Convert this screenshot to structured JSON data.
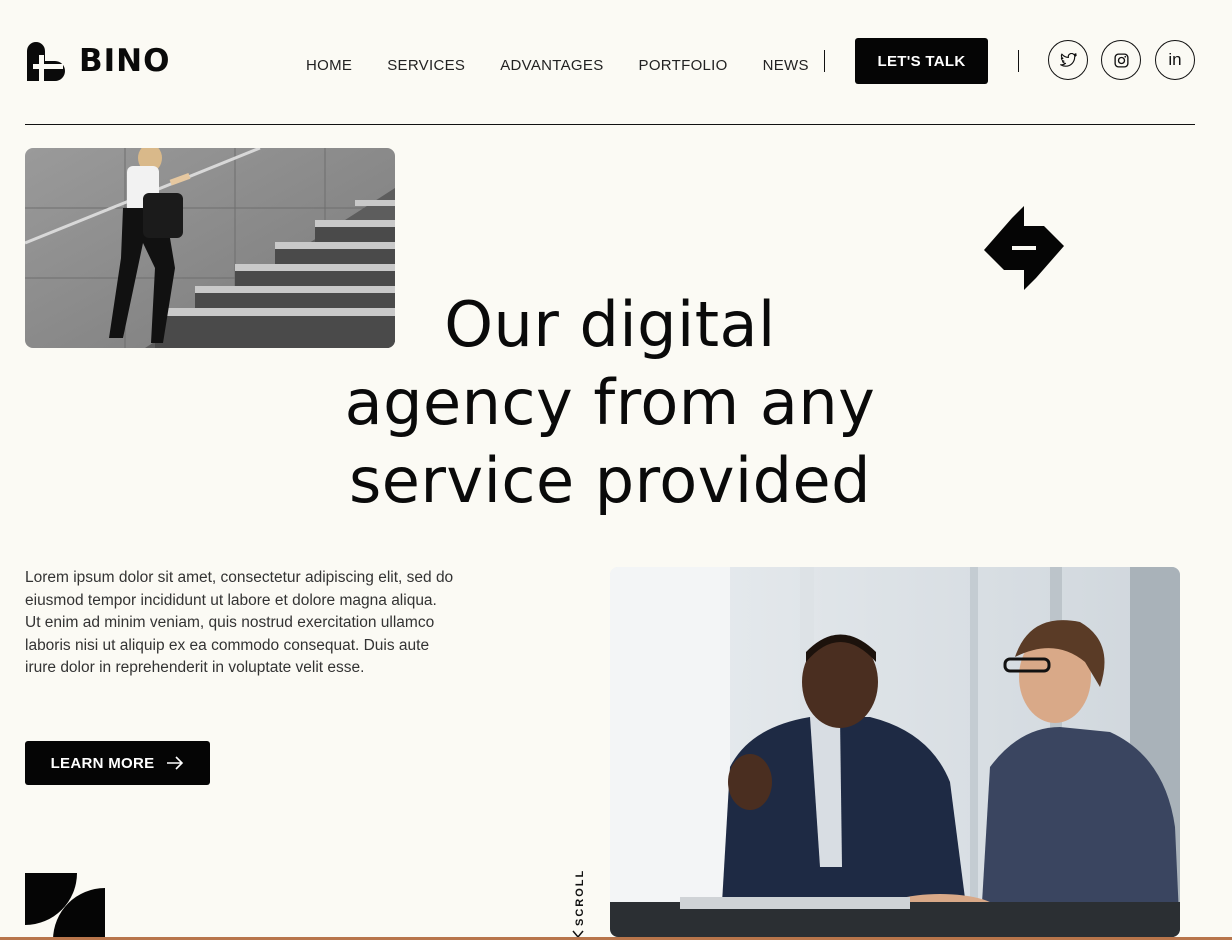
{
  "brand": {
    "name": "BINO"
  },
  "nav": {
    "items": [
      "HOME",
      "SERVICES",
      "ADVANTAGES",
      "PORTFOLIO",
      "NEWS"
    ],
    "cta": "LET'S TALK"
  },
  "social": [
    {
      "icon": "twitter-icon"
    },
    {
      "icon": "instagram-icon"
    },
    {
      "icon": "linkedin-icon",
      "text": "in"
    }
  ],
  "hero": {
    "title_lines": [
      "Our digital",
      "agency from any",
      "service provided"
    ],
    "description": "Lorem ipsum dolor sit amet, consectetur adipiscing elit, sed do eiusmod tempor incididunt ut labore et dolore magna aliqua. Ut enim ad minim veniam, quis nostrud exercitation ullamco laboris nisi ut aliquip ex ea commodo consequat. Duis aute irure dolor in reprehenderit in voluptate velit esse.",
    "button_label": "LEARN MORE",
    "scroll_label": "SCROLL"
  },
  "colors": {
    "background": "#fbfaf4",
    "accent": "#050505",
    "bottom_bar": "#b8754b"
  }
}
